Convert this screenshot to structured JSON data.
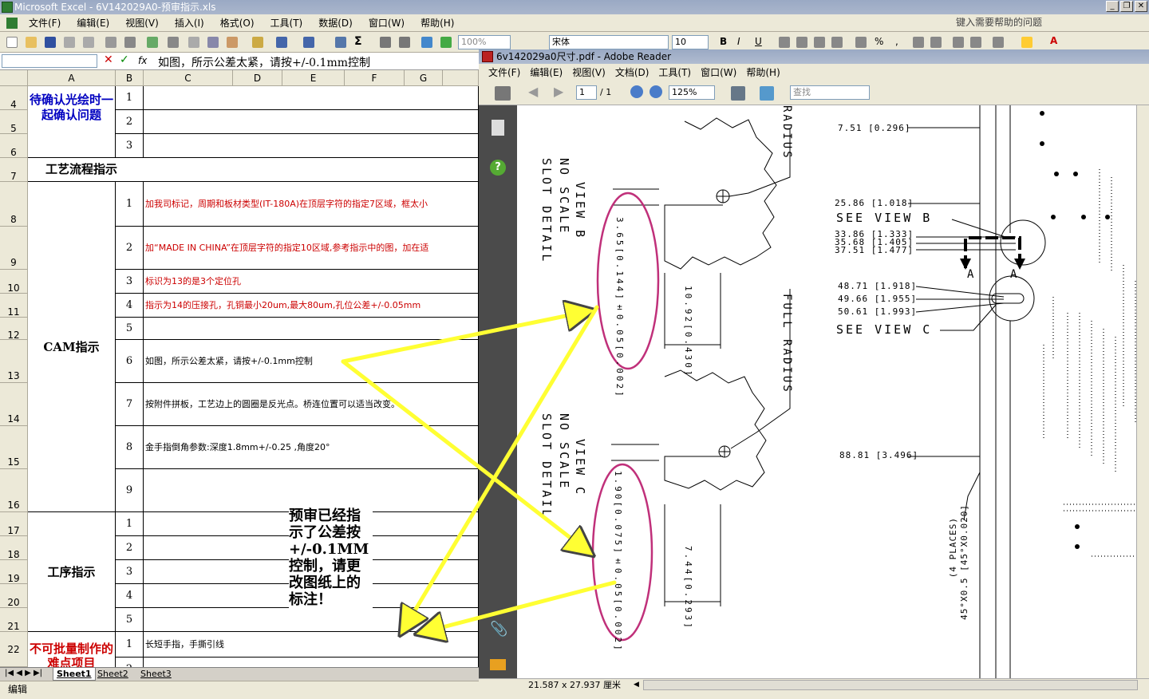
{
  "excel": {
    "title": "Microsoft Excel - 6V142029A0-预审指示.xls",
    "menu": [
      "文件(F)",
      "编辑(E)",
      "视图(V)",
      "插入(I)",
      "格式(O)",
      "工具(T)",
      "数据(D)",
      "窗口(W)",
      "帮助(H)"
    ],
    "help_placeholder": "键入需要帮助的问题",
    "zoom": "100%",
    "font_name": "宋体",
    "font_size": "10",
    "formula": "如图，所示公差太紧，请按+/-0.1mm控制",
    "columns": [
      "A",
      "B",
      "C",
      "D",
      "E",
      "F",
      "G"
    ],
    "rows": [
      "4",
      "5",
      "6",
      "7",
      "8",
      "9",
      "10",
      "11",
      "12",
      "13",
      "14",
      "15",
      "16",
      "17",
      "18",
      "19",
      "20",
      "21",
      "22"
    ],
    "sections": {
      "confirm": "待确认光绘时一起确认问题",
      "process": "工艺流程指示",
      "cam": "CAM指示",
      "procedure": "工序指示",
      "hard": "不可批量制作的难点项目"
    },
    "confirm_nums": [
      "1",
      "2",
      "3"
    ],
    "cam_nums": [
      "1",
      "2",
      "3",
      "4",
      "5",
      "6",
      "7",
      "8",
      "9"
    ],
    "cam_texts": [
      "加我司标记，周期和板材类型(IT-180A)在顶层字符的指定7区域，框太小",
      "加“MADE IN CHINA”在顶层字符的指定10区域,参考指示中的图，加在适",
      "标识为13的是3个定位孔",
      "指示为14的压接孔，孔铜最小20um,最大80um,孔位公差+/-0.05mm",
      "",
      "如图，所示公差太紧，请按+/-0.1mm控制",
      "按附件拼板，工艺边上的圆圈是反光点。桥连位置可以适当改变。",
      "金手指倒角参数:深度1.8mm+/-0.25 ,角度20°",
      ""
    ],
    "proc_nums": [
      "1",
      "2",
      "3",
      "4",
      "5"
    ],
    "hard_nums": [
      "1",
      "2"
    ],
    "hard_text": "长短手指，手撕引线",
    "note": "预审已经指示了公差按+/-0.1MM控制，请更改图纸上的标注！",
    "sheets": [
      "Sheet1",
      "Sheet2",
      "Sheet3"
    ],
    "status": "编辑"
  },
  "reader": {
    "title": "6v142029a0尺寸.pdf - Adobe Reader",
    "menu": [
      "文件(F)",
      "编辑(E)",
      "视图(V)",
      "文档(D)",
      "工具(T)",
      "窗口(W)",
      "帮助(H)"
    ],
    "page": "1",
    "page_total": "/ 1",
    "zoom": "125%",
    "search_placeholder": "查找",
    "page_size": "21.587 x 27.937 厘米",
    "drawing": {
      "view_b": "VIEW B",
      "view_c": "VIEW C",
      "slot_detail": "SLOT DETAIL",
      "no_scale": "NO SCALE",
      "full_radius": "FULL RADIUS",
      "radius_top": "RADIUS",
      "dim_b_w": "3.65[0.144]±0.05[0.002]",
      "dim_b_h": "10.92[0.430]",
      "dim_c_w": "1.90[0.075]±0.05[0.002]",
      "dim_c_h": "7.44[0.293]",
      "d1": "7.51 [0.296]",
      "d2": "25.86 [1.018]",
      "see_b": "SEE VIEW B",
      "d3": "33.86 [1.333]",
      "d4": "35.68 [1.405]",
      "d5": "37.51 [1.477]",
      "d6": "48.71 [1.918]",
      "d7": "49.66 [1.955]",
      "d8": "50.61 [1.993]",
      "see_c": "SEE VIEW C",
      "d9": "88.81 [3.496]",
      "chamfer": "45°X0.5 [45°X0.020]",
      "places": "(4 PLACES)",
      "a_left": "A",
      "a_right": "A"
    }
  },
  "colors": {
    "highlight_arrow": "#ffff33",
    "ellipse": "#c0307a",
    "red_text": "#cc0000",
    "blue_text": "#0000c0"
  }
}
